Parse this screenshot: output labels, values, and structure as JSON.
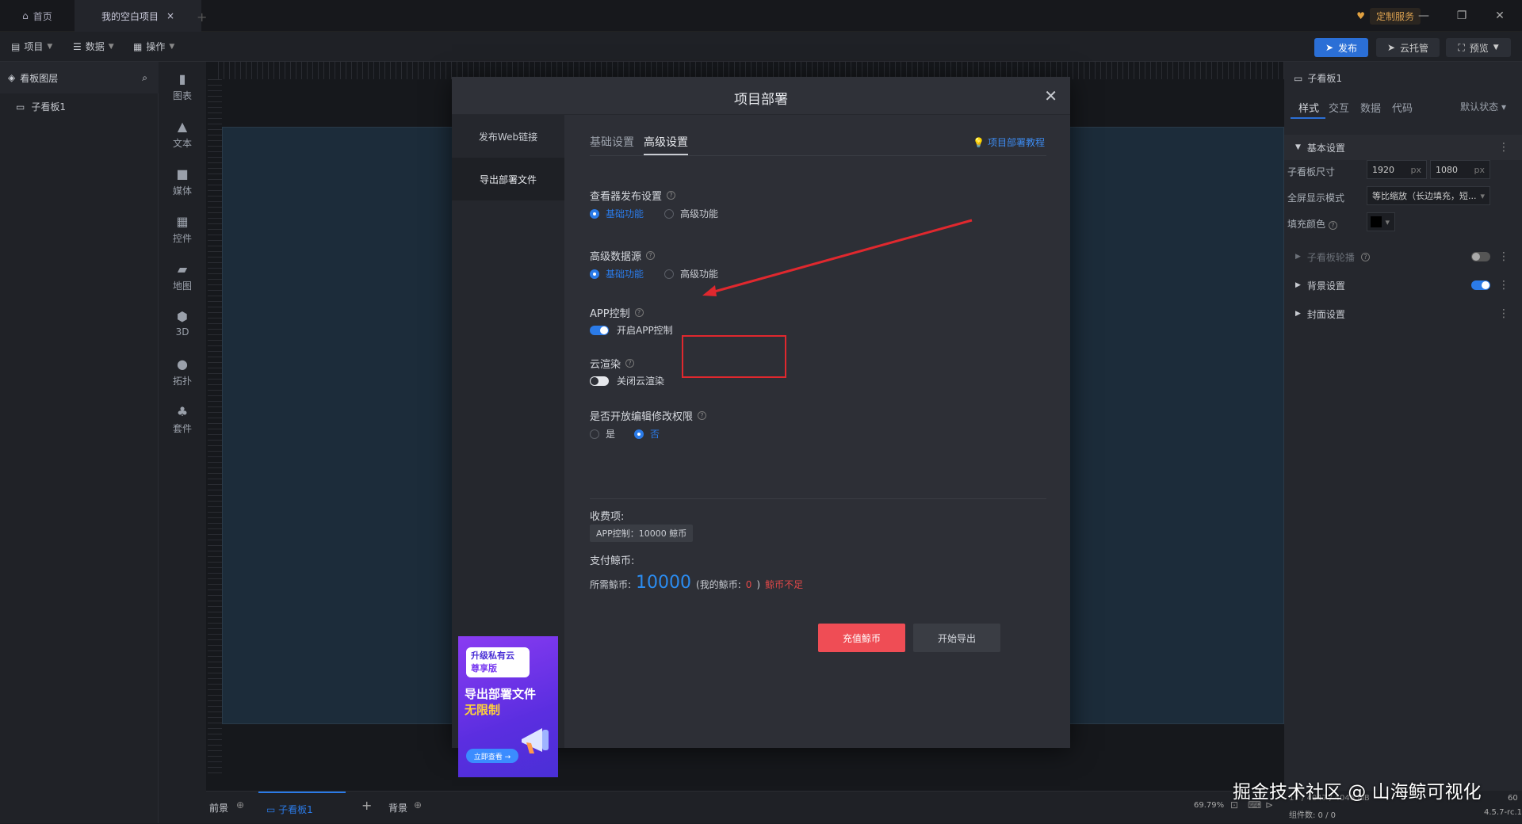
{
  "topbar": {
    "home_tab": "首页",
    "project_tab": "我的空白项目",
    "custom_service": "定制服务"
  },
  "menubar": {
    "project": "项目",
    "data": "数据",
    "operate": "操作",
    "publish": "发布",
    "cloud_host": "云托管",
    "preview": "预览"
  },
  "layers": {
    "title": "看板图层",
    "item": "子看板1"
  },
  "comp_tools": [
    {
      "label": "图表",
      "icon": "bar-chart-icon"
    },
    {
      "label": "文本",
      "icon": "text-icon"
    },
    {
      "label": "媒体",
      "icon": "media-icon"
    },
    {
      "label": "控件",
      "icon": "widget-icon"
    },
    {
      "label": "地图",
      "icon": "map-icon"
    },
    {
      "label": "3D",
      "icon": "cube-icon"
    },
    {
      "label": "拓扑",
      "icon": "topology-icon"
    },
    {
      "label": "套件",
      "icon": "suite-icon"
    }
  ],
  "props": {
    "title": "子看板1",
    "tabs": [
      "样式",
      "交互",
      "数据",
      "代码"
    ],
    "state": "默认状态",
    "basic_section": "基本设置",
    "size_label": "子看板尺寸",
    "width": "1920",
    "height": "1080",
    "unit": "px",
    "fullscreen_label": "全屏显示模式",
    "fullscreen_value": "等比缩放（长边填充，短...",
    "fill_label": "填充颜色",
    "carousel": "子看板轮播",
    "background": "背景设置",
    "cover": "封面设置"
  },
  "bottombar": {
    "front": "前景",
    "board": "子看板1",
    "back": "背景",
    "zoom": "69.79%",
    "status_partial": "17 / 4047 / 4046 MB",
    "fps": "60",
    "components": "组件数: 0 / 0",
    "version": "4.5.7-rc.1"
  },
  "modal": {
    "title": "项目部署",
    "side_items": [
      "发布Web链接",
      "导出部署文件"
    ],
    "tabs": [
      "基础设置",
      "高级设置"
    ],
    "tutorial": "项目部署教程",
    "viewer_title": "查看器发布设置",
    "viewer_opts": [
      "基础功能",
      "高级功能"
    ],
    "datasource_title": "高级数据源",
    "datasource_opts": [
      "基础功能",
      "高级功能"
    ],
    "app_title": "APP控制",
    "app_switch": "开启APP控制",
    "cloud_title": "云渲染",
    "cloud_switch": "关闭云渲染",
    "edit_title": "是否开放编辑修改权限",
    "edit_opts": [
      "是",
      "否"
    ],
    "fee_title": "收费项:",
    "fee_item": "APP控制：10000 鲸币",
    "pay_title": "支付鲸币:",
    "need_label": "所需鲸币:",
    "need_amount": "10000",
    "my_coin_label": "(我的鲸币:",
    "my_coin": "0",
    "my_coin_close": ")",
    "short": "鲸币不足",
    "recharge": "充值鲸币",
    "start_export": "开始导出",
    "ad": {
      "badge_line1": "升级私有云",
      "badge_line2": "尊享版",
      "title": "导出部署文件",
      "subtitle": "无限制",
      "button": "立即查看 →"
    }
  },
  "watermark": "掘金技术社区 @ 山海鲸可视化",
  "colors": {
    "accent": "#2b7be8",
    "danger": "#ef4d55",
    "annotation": "#e0282e"
  }
}
